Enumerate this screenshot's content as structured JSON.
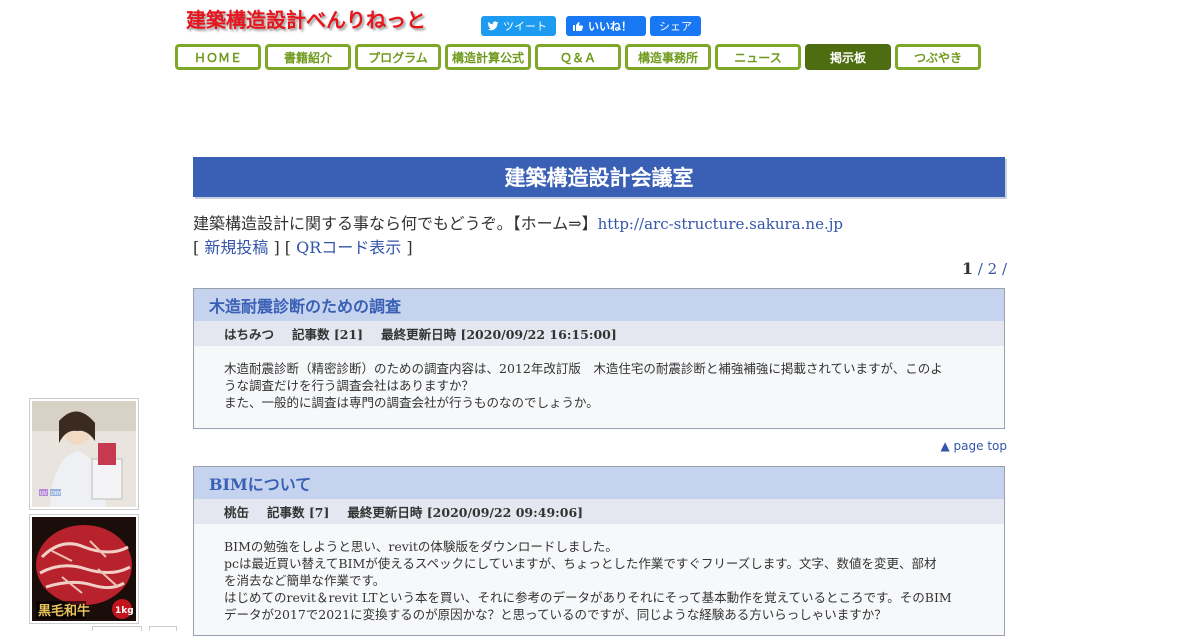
{
  "site": {
    "logo": "建築構造設計べんりねっと"
  },
  "social": {
    "tweet": "ツイート",
    "like": "いいね！",
    "share": "シェア"
  },
  "nav": [
    {
      "label": "ＨＯＭＥ"
    },
    {
      "label": "書籍紹介"
    },
    {
      "label": "プログラム"
    },
    {
      "label": "構造計算公式"
    },
    {
      "label": "Ｑ＆Ａ"
    },
    {
      "label": "構造事務所"
    },
    {
      "label": "ニュース"
    },
    {
      "label": "掲示板",
      "active": true
    },
    {
      "label": "つぶやき"
    }
  ],
  "board": {
    "title": "建築構造設計会議室",
    "intro_text": "建築構造設計に関する事なら何でもどうぞ。【ホーム⇒】",
    "home_url": "http://arc-structure.sakura.ne.jp",
    "new_post": "新規投稿",
    "qr_code": "QRコード表示",
    "bracket_open": "[",
    "bracket_close": "]"
  },
  "pager": {
    "current": "1",
    "sep": "/",
    "next": "2"
  },
  "page_top": "▲ page top",
  "threads": [
    {
      "title": "木造耐震診断のための調査",
      "author": "はちみつ",
      "count": "記事数 [21]",
      "updated": "最終更新日時 [2020/09/22 16:15:00]",
      "body": [
        "木造耐震診断（精密診断）のための調査内容は、2012年改訂版　木造住宅の耐震診断と補強補強に掲載されていますが、このよ",
        "うな調査だけを行う調査会社はありますか？",
        "また、一般的に調査は専門の調査会社が行うものなのでしょうか。"
      ]
    },
    {
      "title": "BIMについて",
      "author": "桃缶",
      "count": "記事数 [7]",
      "updated": "最終更新日時 [2020/09/22 09:49:06]",
      "body": [
        "BIMの勉強をしようと思い、revitの体験版をダウンロードしました。",
        "pcは最近買い替えてBIMが使えるスペックにしていますが、ちょっとした作業ですぐフリーズします。文字、数値を変更、部材",
        "を消去など簡単な作業です。",
        "はじめてのrevit＆revit LTという本を買い、それに参考のデータがありそれにそって基本動作を覚えているところです。そのBIM",
        "データが2017で2021に変換するのが原因かな？と思っているのですが、同じような経験ある方いらっしゃいますか？"
      ]
    }
  ],
  "ads": {
    "ad1": {
      "lines": [
        "UV",
        "DRY"
      ]
    },
    "ad2": {
      "caption": "黒毛和牛",
      "weight": "1kg"
    }
  }
}
